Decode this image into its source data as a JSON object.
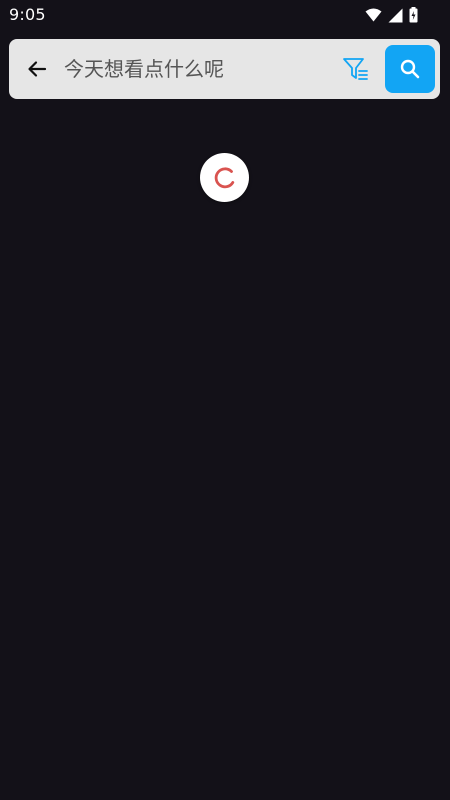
{
  "status_bar": {
    "time": "9:05",
    "icons": [
      "wifi-icon",
      "signal-icon",
      "battery-icon"
    ]
  },
  "search": {
    "placeholder": "今天想看点什么呢",
    "value": "",
    "back_icon": "arrow-left-icon",
    "filter_icon": "filter-icon",
    "submit_icon": "search-icon"
  },
  "loading": {
    "icon": "spinner-icon"
  },
  "colors": {
    "background": "#131118",
    "search_bar": "#e6e6e6",
    "accent": "#12a5f4",
    "spinner": "#d9534f"
  }
}
